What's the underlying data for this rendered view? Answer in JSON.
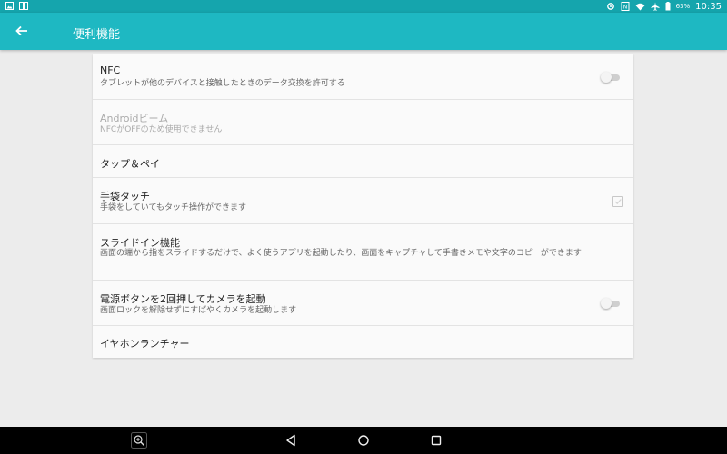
{
  "status_bar": {
    "battery_percent": "63%",
    "time": "10:35",
    "left_icons": [
      "gallery-notification-icon",
      "book-notification-icon"
    ],
    "right_icons": [
      "settings-sync-icon",
      "nfc-icon",
      "wifi-icon",
      "airplane-mode-icon",
      "battery-icon"
    ]
  },
  "app_bar": {
    "title": "便利機能",
    "back_icon": "arrow-left-icon"
  },
  "settings": [
    {
      "title": "NFC",
      "subtitle": "タブレットが他のデバイスと接触したときのデータ交換を許可する",
      "control": "toggle",
      "state": "off"
    },
    {
      "title": "Androidビーム",
      "subtitle": "NFCがOFFのため使用できません",
      "disabled": true
    },
    {
      "title": "タップ＆ペイ"
    },
    {
      "title": "手袋タッチ",
      "subtitle": "手袋をしていてもタッチ操作ができます",
      "control": "checkbox",
      "state": "unchecked"
    },
    {
      "title": "スライドイン機能",
      "subtitle": "画面の端から指をスライドするだけで、よく使うアプリを起動したり、画面をキャプチャして手書きメモや文字のコピーができます"
    },
    {
      "title": "電源ボタンを2回押してカメラを起動",
      "subtitle": "画面ロックを解除せずにすばやくカメラを起動します",
      "control": "toggle",
      "state": "off"
    },
    {
      "title": "イヤホンランチャー"
    }
  ],
  "nav_bar": {
    "buttons": [
      "zoom-in-icon",
      "back-triangle-icon",
      "home-circle-icon",
      "recents-square-icon"
    ]
  },
  "colors": {
    "status_bar": "#15a5ad",
    "app_bar": "#1eb8c2",
    "background": "#ececec",
    "card": "#fafafa",
    "nav_bar": "#000000"
  }
}
